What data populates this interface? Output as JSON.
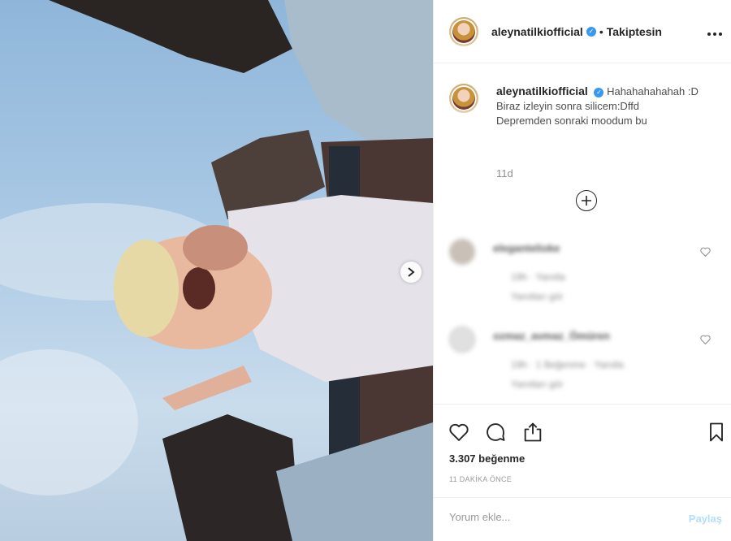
{
  "post": {
    "author": "aleynatilkiofficial",
    "follow_status": "Takiptesin",
    "more_icon": "more-icon",
    "verified_icon": "verified-icon"
  },
  "caption": {
    "username": "aleynatilkiofficial",
    "lines": [
      "Hahahahahahah :D",
      "Biraz izleyin sonra silicem:Dffd",
      "Depremden sonraki moodum bu"
    ],
    "time": "11d"
  },
  "comments": [
    {
      "username": "elegantelioke",
      "meta1": "19h · Yanıtla",
      "meta2": "Yanıtları gör"
    },
    {
      "username": "ozmaz_avmaz_Ömüren",
      "meta1": "19h · 1 Beğenme · Yanıtla",
      "meta2": "Yanıtları gör"
    }
  ],
  "actions": {
    "like_icon": "heart-icon",
    "comment_icon": "comment-icon",
    "share_icon": "share-icon",
    "save_icon": "bookmark-icon"
  },
  "likes_text": "3.307 beğenme",
  "time_ago": "11 DAKİKA ÖNCE",
  "composer": {
    "placeholder": "Yorum ekle...",
    "post_label": "Paylaş"
  },
  "colors": {
    "verified": "#3897f0",
    "post_button_disabled": "#b2dffc"
  }
}
